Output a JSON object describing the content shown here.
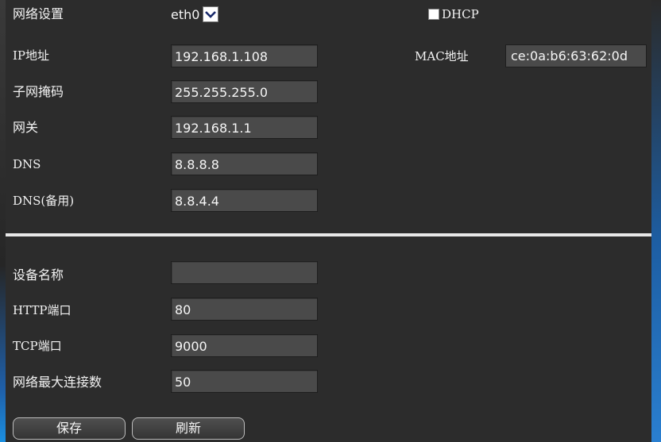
{
  "network": {
    "adapter_label": "网络设置",
    "adapter_value": "eth0",
    "dhcp_label": "DHCP",
    "dhcp_checked": false,
    "ip_label": "IP地址",
    "ip_value": "192.168.1.108",
    "mac_label": "MAC地址",
    "mac_value": "ce:0a:b6:63:62:0d",
    "subnet_label": "子网掩码",
    "subnet_value": "255.255.255.0",
    "gateway_label": "网关",
    "gateway_value": "192.168.1.1",
    "dns_label": "DNS",
    "dns_value": "8.8.8.8",
    "dns_alt_label": "DNS(备用)",
    "dns_alt_value": "8.8.4.4"
  },
  "device": {
    "name_label": "设备名称",
    "name_value": "",
    "http_label": "HTTP端口",
    "http_value": "80",
    "tcp_label": "TCP端口",
    "tcp_value": "9000",
    "maxconn_label": "网络最大连接数",
    "maxconn_value": "50"
  },
  "actions": {
    "save_label": "保存",
    "refresh_label": "刷新"
  },
  "colors": {
    "background": "#2c2c2c",
    "field": "#4a4a4a",
    "divider": "#e8e8e8",
    "accent_blue": "#1b8fe0"
  }
}
